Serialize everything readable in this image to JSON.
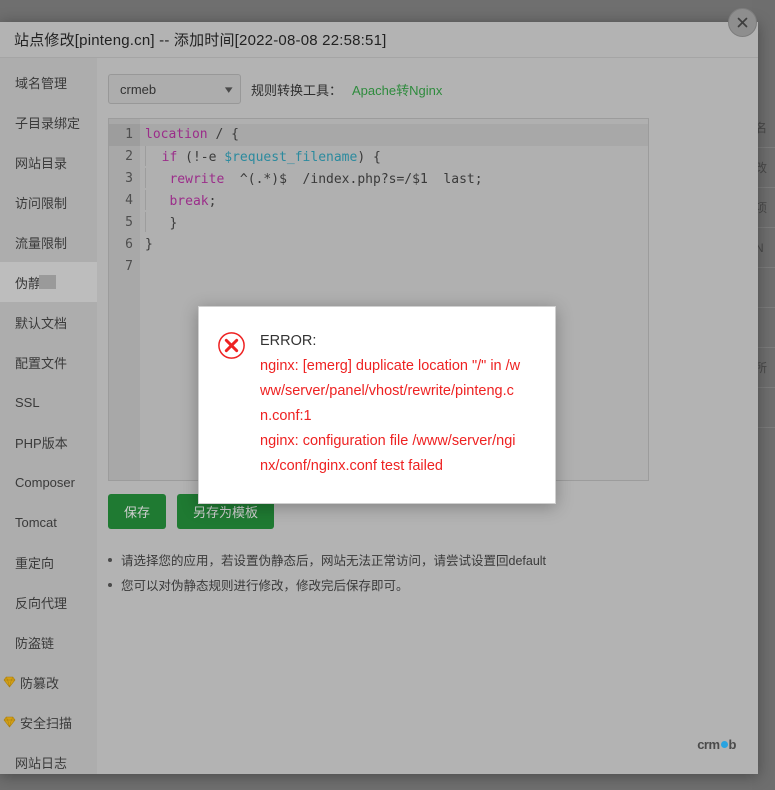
{
  "window": {
    "title": "站点修改[pinteng.cn] -- 添加时间[2022-08-08 22:58:51]",
    "close_icon": "close-icon"
  },
  "sidebar": {
    "items": [
      {
        "label": "域名管理",
        "active": false,
        "gem": false
      },
      {
        "label": "子目录绑定",
        "active": false,
        "gem": false
      },
      {
        "label": "网站目录",
        "active": false,
        "gem": false
      },
      {
        "label": "访问限制",
        "active": false,
        "gem": false
      },
      {
        "label": "流量限制",
        "active": false,
        "gem": false
      },
      {
        "label": "伪静态",
        "active": true,
        "gem": false
      },
      {
        "label": "默认文档",
        "active": false,
        "gem": false
      },
      {
        "label": "配置文件",
        "active": false,
        "gem": false
      },
      {
        "label": "SSL",
        "active": false,
        "gem": false
      },
      {
        "label": "PHP版本",
        "active": false,
        "gem": false
      },
      {
        "label": "Composer",
        "active": false,
        "gem": false
      },
      {
        "label": "Tomcat",
        "active": false,
        "gem": false
      },
      {
        "label": "重定向",
        "active": false,
        "gem": false
      },
      {
        "label": "反向代理",
        "active": false,
        "gem": false
      },
      {
        "label": "防盗链",
        "active": false,
        "gem": false
      },
      {
        "label": "防篡改",
        "active": false,
        "gem": true
      },
      {
        "label": "安全扫描",
        "active": false,
        "gem": true
      },
      {
        "label": "网站日志",
        "active": false,
        "gem": false
      }
    ]
  },
  "toolbar": {
    "selected_rule": "crmeb",
    "caret_icon": "chevron-down-icon",
    "converter_label": "规则转换工具：",
    "converter_link": "Apache转Nginx"
  },
  "editor": {
    "active_line": 1,
    "line_numbers": [
      "1",
      "2",
      "3",
      "4",
      "5",
      "6",
      "7"
    ],
    "lines": [
      {
        "n": "1",
        "indent": 0,
        "tokens": [
          {
            "t": "location",
            "c": "kw"
          },
          {
            "t": " / {",
            "c": ""
          }
        ]
      },
      {
        "n": "2",
        "indent": 1,
        "tokens": [
          {
            "t": "  ",
            "c": ""
          },
          {
            "t": "if",
            "c": "kw"
          },
          {
            "t": " (!-e ",
            "c": ""
          },
          {
            "t": "$request_filename",
            "c": "var"
          },
          {
            "t": ") {",
            "c": ""
          }
        ]
      },
      {
        "n": "3",
        "indent": 1,
        "tokens": [
          {
            "t": "   ",
            "c": ""
          },
          {
            "t": "rewrite",
            "c": "kw"
          },
          {
            "t": "  ^(.*)$  /index.php?s=/$1  last;",
            "c": ""
          }
        ]
      },
      {
        "n": "4",
        "indent": 1,
        "tokens": [
          {
            "t": "   ",
            "c": ""
          },
          {
            "t": "break",
            "c": "kw"
          },
          {
            "t": ";",
            "c": ""
          }
        ]
      },
      {
        "n": "5",
        "indent": 1,
        "tokens": [
          {
            "t": "   }",
            "c": ""
          }
        ]
      },
      {
        "n": "6",
        "indent": 0,
        "tokens": [
          {
            "t": "}",
            "c": ""
          }
        ]
      },
      {
        "n": "7",
        "indent": 0,
        "tokens": [
          {
            "t": "",
            "c": ""
          }
        ]
      }
    ]
  },
  "actions": {
    "save_label": "保存",
    "save_as_template_label": "另存为模板"
  },
  "hints": [
    "请选择您的应用，若设置伪静态后，网站无法正常访问，请尝试设置回default",
    "您可以对伪静态规则进行修改，修改完后保存即可。"
  ],
  "error_dialog": {
    "icon": "error-circle-x-icon",
    "heading": "ERROR:",
    "message": "nginx: [emerg] duplicate location \"/\" in /www/server/panel/vhost/rewrite/pinteng.cn.conf:1\nnginx: configuration file /www/server/nginx/conf/nginx.conf test failed",
    "message_lines": [
      "nginx: [emerg] duplicate location \"/\" in /w",
      "ww/server/panel/vhost/rewrite/pinteng.c",
      "n.conf:1",
      "nginx: configuration file /www/server/ngi",
      "nx/conf/nginx.conf test failed"
    ]
  },
  "watermark": {
    "text_before": "crm",
    "text_after": "b"
  },
  "background_panel": {
    "rows": [
      "名",
      "改",
      "项",
      "N",
      "",
      "",
      "所",
      ""
    ]
  },
  "colors": {
    "accent_green": "#1f7a32",
    "link_green": "#2e8b3d",
    "error_red": "#ee2222",
    "modal_bg": "#b3b3b3",
    "sidebar_bg": "#adadad",
    "gem_gold": "#d4a017",
    "watermark_blue": "#29a3e0"
  }
}
